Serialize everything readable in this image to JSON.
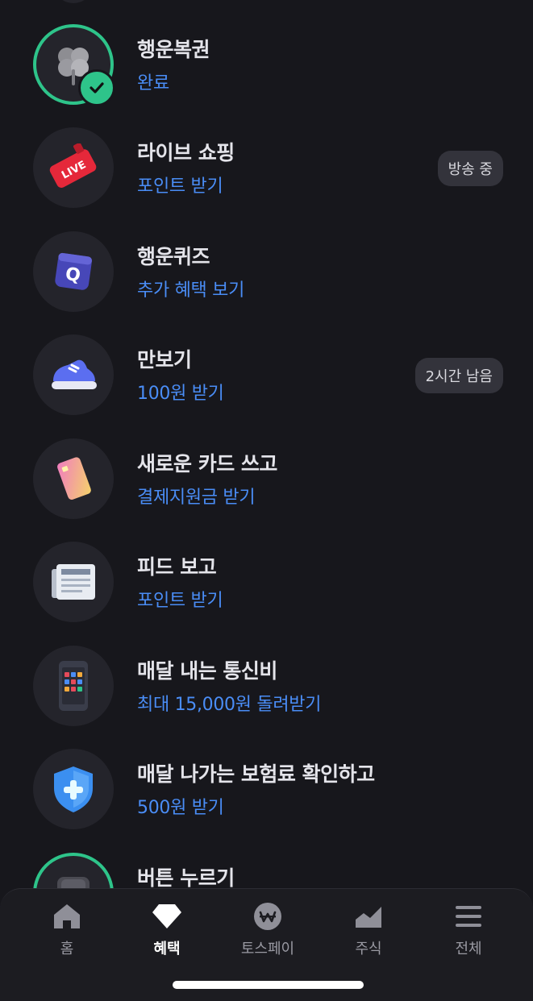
{
  "list": [
    {
      "title": "행운복권",
      "sub": "완료",
      "badge": null,
      "icon": "clover-icon",
      "done": true
    },
    {
      "title": "라이브 쇼핑",
      "sub": "포인트 받기",
      "badge": "방송 중",
      "icon": "live-tv-icon",
      "done": false
    },
    {
      "title": "행운퀴즈",
      "sub": "추가 혜택 보기",
      "badge": null,
      "icon": "quiz-q-icon",
      "done": false
    },
    {
      "title": "만보기",
      "sub": "100원 받기",
      "badge": "2시간 남음",
      "icon": "sneaker-icon",
      "done": false
    },
    {
      "title": "새로운 카드 쓰고",
      "sub": "결제지원금 받기",
      "badge": null,
      "icon": "credit-card-icon",
      "done": false
    },
    {
      "title": "피드 보고",
      "sub": "포인트 받기",
      "badge": null,
      "icon": "newspaper-icon",
      "done": false
    },
    {
      "title": "매달 내는 통신비",
      "sub": "최대 15,000원 돌려받기",
      "badge": null,
      "icon": "phone-icon",
      "done": false
    },
    {
      "title": "매달 나가는 보험료 확인하고",
      "sub": "500원 받기",
      "badge": null,
      "icon": "shield-plus-icon",
      "done": false
    },
    {
      "title": "버튼 누르기",
      "sub": "",
      "badge": null,
      "icon": "keycap-icon",
      "done": true
    }
  ],
  "tabbar": {
    "tabs": [
      {
        "label": "홈",
        "icon": "home-icon",
        "active": false
      },
      {
        "label": "혜택",
        "icon": "diamond-icon",
        "active": true
      },
      {
        "label": "토스페이",
        "icon": "won-coin-icon",
        "active": false
      },
      {
        "label": "주식",
        "icon": "stock-chart-icon",
        "active": false
      },
      {
        "label": "전체",
        "icon": "menu-icon",
        "active": false
      }
    ]
  },
  "colors": {
    "accent_blue": "#4a8df6",
    "success_green": "#2ec48a",
    "background": "#17171c"
  }
}
